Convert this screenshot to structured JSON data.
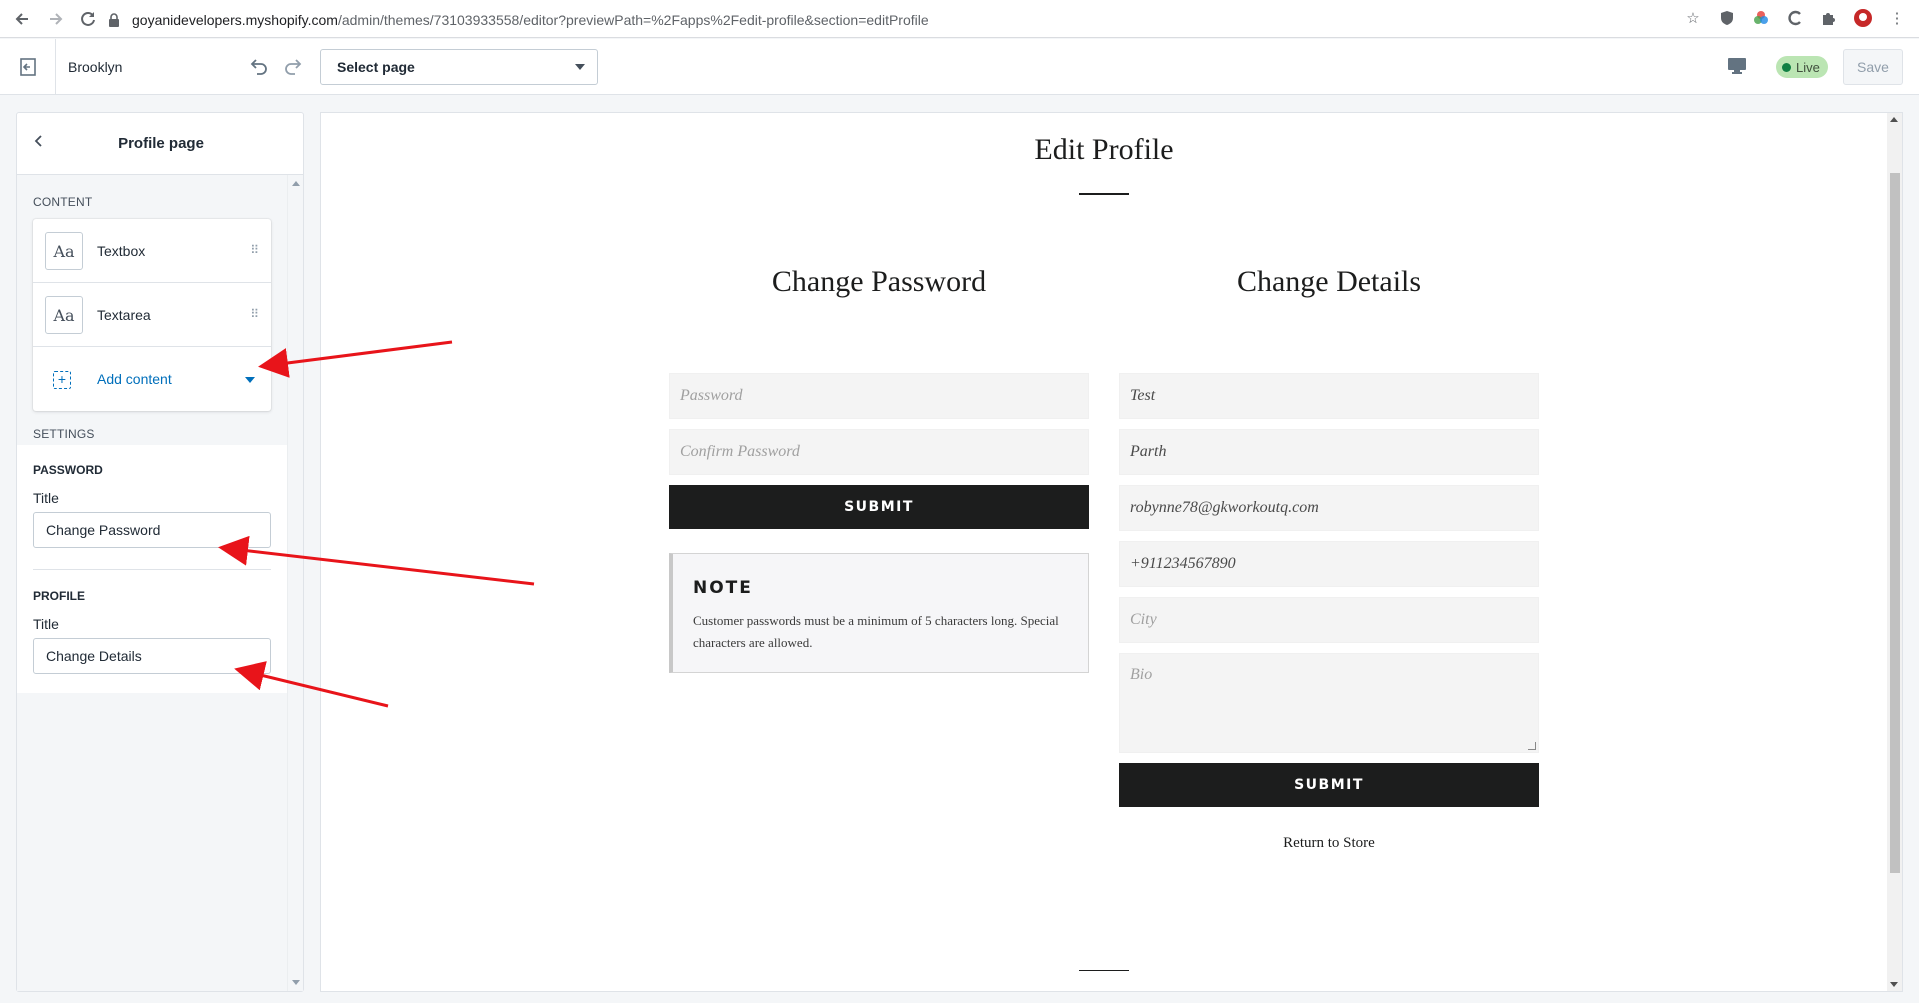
{
  "browser": {
    "url_host": "goyanidevelopers.myshopify.com",
    "url_path": "/admin/themes/73103933558/editor?previewPath=%2Fapps%2Fedit-profile&section=editProfile"
  },
  "editor": {
    "theme_name": "Brooklyn",
    "select_page_label": "Select page",
    "live_label": "Live",
    "save_label": "Save"
  },
  "sidebar": {
    "title": "Profile page",
    "content_label": "CONTENT",
    "blocks": [
      {
        "icon": "Aa",
        "label": "Textbox"
      },
      {
        "icon": "Aa",
        "label": "Textarea"
      }
    ],
    "add_content_label": "Add content",
    "settings_label": "SETTINGS",
    "password_group": "PASSWORD",
    "password_title_label": "Title",
    "password_title_value": "Change Password",
    "profile_group": "PROFILE",
    "profile_title_label": "Title",
    "profile_title_value": "Change Details"
  },
  "preview": {
    "page_title": "Edit Profile",
    "password_col": {
      "title": "Change Password",
      "password_placeholder": "Password",
      "confirm_placeholder": "Confirm Password",
      "submit_label": "SUBMIT",
      "note_title": "NOTE",
      "note_text": "Customer passwords must be a minimum of 5 characters long. Special characters are allowed."
    },
    "details_col": {
      "title": "Change Details",
      "field_1": "Test",
      "field_2": "Parth",
      "email": "robynne78@gkworkoutq.com",
      "phone": "+911234567890",
      "city_placeholder": "City",
      "bio_placeholder": "Bio",
      "submit_label": "SUBMIT",
      "return_link": "Return to Store"
    }
  },
  "colors": {
    "annotation_arrow": "#e8141a",
    "link_blue": "#006fbb",
    "live_green": "#108043",
    "button_dark": "#1c1d1d"
  }
}
